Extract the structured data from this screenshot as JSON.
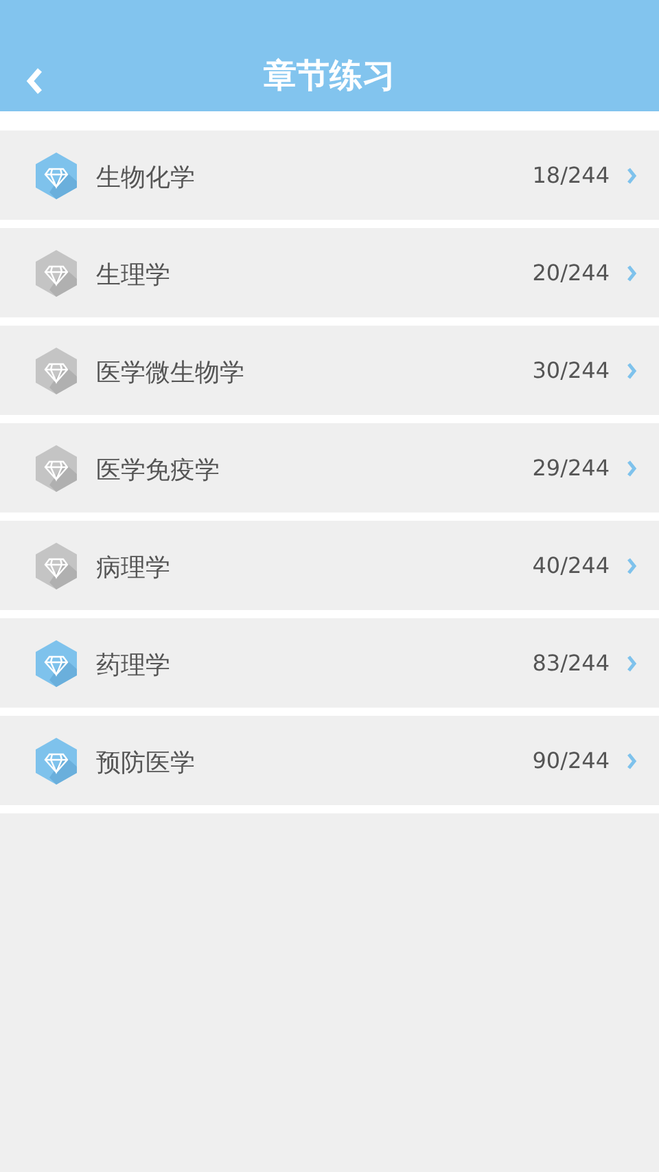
{
  "header": {
    "title": "章节练习"
  },
  "chapters": [
    {
      "name": "生物化学",
      "progress": "18/244",
      "active": true
    },
    {
      "name": "生理学",
      "progress": "20/244",
      "active": false
    },
    {
      "name": "医学微生物学",
      "progress": "30/244",
      "active": false
    },
    {
      "name": "医学免疫学",
      "progress": "29/244",
      "active": false
    },
    {
      "name": "病理学",
      "progress": "40/244",
      "active": false
    },
    {
      "name": "药理学",
      "progress": "83/244",
      "active": true
    },
    {
      "name": "预防医学",
      "progress": "90/244",
      "active": true
    }
  ]
}
